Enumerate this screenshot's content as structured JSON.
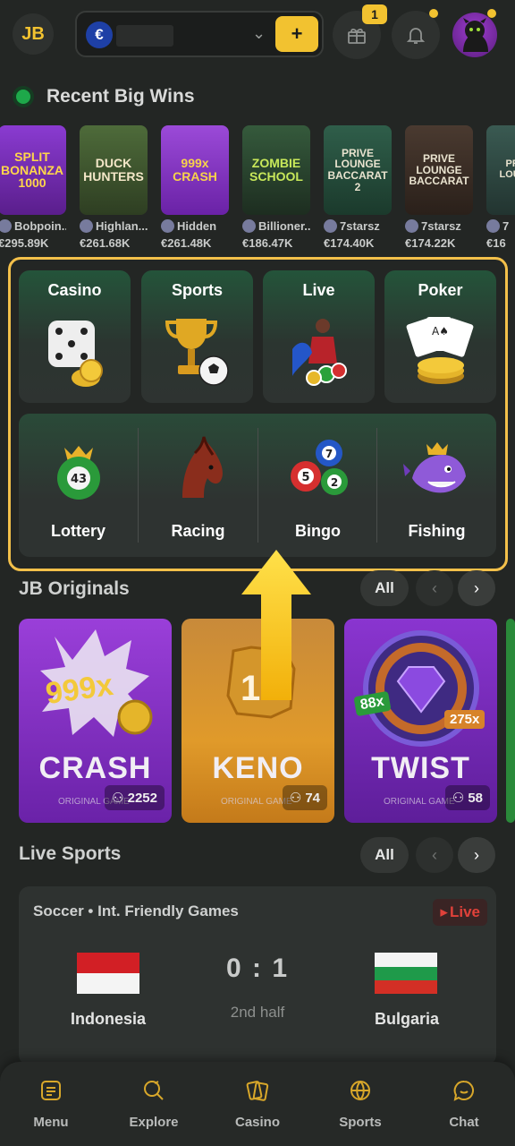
{
  "header": {
    "logo": "JB",
    "currency_symbol": "€",
    "deposit_label": "+",
    "gift_badge_count": "1"
  },
  "recent_big_wins": {
    "title": "Recent Big Wins",
    "items": [
      {
        "game": "SPLIT BONANZA 1000",
        "user": "Bobpoin...",
        "amount": "€295.89K"
      },
      {
        "game": "DUCK HUNTERS",
        "user": "Highlan...",
        "amount": "€261.68K"
      },
      {
        "game": "999x CRASH",
        "user": "Hidden",
        "amount": "€261.48K"
      },
      {
        "game": "ZOMBIE SCHOOL",
        "user": "Billioner...",
        "amount": "€186.47K"
      },
      {
        "game": "PRIVE LOUNGE BACCARAT 2",
        "user": "7starsz",
        "amount": "€174.40K"
      },
      {
        "game": "PRIVE LOUNGE BACCARAT",
        "user": "7starsz",
        "amount": "€174.22K"
      },
      {
        "game": "PRIVE LOUNGE",
        "user": "7",
        "amount": "€16"
      }
    ]
  },
  "categories": {
    "top": [
      {
        "label": "Casino",
        "icon": "dice-icon"
      },
      {
        "label": "Sports",
        "icon": "trophy-ball-icon"
      },
      {
        "label": "Live",
        "icon": "live-dealer-icon"
      },
      {
        "label": "Poker",
        "icon": "cards-chips-icon"
      }
    ],
    "bottom": [
      {
        "label": "Lottery",
        "icon": "lottery-ball-icon"
      },
      {
        "label": "Racing",
        "icon": "horse-icon"
      },
      {
        "label": "Bingo",
        "icon": "bingo-balls-icon"
      },
      {
        "label": "Fishing",
        "icon": "shark-icon"
      }
    ]
  },
  "originals": {
    "title": "JB Originals",
    "all_label": "All",
    "items": [
      {
        "name": "CRASH",
        "sub": "ORIGINAL GAME",
        "players": "2252",
        "art_label": "999x"
      },
      {
        "name": "KENO",
        "sub": "ORIGINAL GAME",
        "players": "74",
        "art_label": "1"
      },
      {
        "name": "TWIST",
        "sub": "ORIGINAL GAME",
        "players": "58",
        "art_label": "88x",
        "art_label2": "275x"
      }
    ]
  },
  "live_sports": {
    "title": "Live Sports",
    "all_label": "All",
    "match": {
      "sport": "Soccer",
      "league": "Int. Friendly Games",
      "live_label": "Live",
      "home_team": "Indonesia",
      "away_team": "Bulgaria",
      "score": "0 : 1",
      "period": "2nd half"
    }
  },
  "bottom_nav": [
    {
      "label": "Menu",
      "icon": "menu-icon"
    },
    {
      "label": "Explore",
      "icon": "explore-icon"
    },
    {
      "label": "Casino",
      "icon": "casino-icon"
    },
    {
      "label": "Sports",
      "icon": "sports-ball-icon"
    },
    {
      "label": "Chat",
      "icon": "chat-icon"
    }
  ],
  "colors": {
    "background": "#232624",
    "accent": "#f2c230",
    "highlight_frame": "#f3c04a",
    "live_red": "#e0413a"
  }
}
